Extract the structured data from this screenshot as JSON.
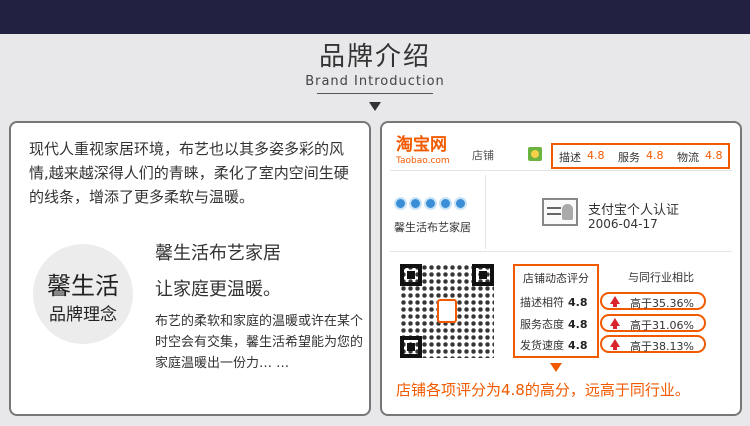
{
  "header": {
    "title_cn": "品牌介绍",
    "title_en": "Brand Introduction"
  },
  "left": {
    "intro": "现代人重视家居环境，布艺也以其多姿多彩的风情,越来越深得人们的青睐，柔化了室内空间生硬的线条，增添了更多柔软与温暖。",
    "circle_line1": "馨生活",
    "circle_line2": "品牌理念",
    "slogan1": "馨生活布艺家居",
    "slogan2": "让家庭更温暖。",
    "paragraph": "布艺的柔软和家庭的温暖或许在某个时空会有交集，馨生活希望能为您的家庭温暖出一份力… …"
  },
  "right": {
    "taobao_logo": "淘宝网",
    "taobao_sub": "Taobao.com",
    "store_label": "店铺",
    "scores": [
      {
        "label": "描述",
        "value": "4.8"
      },
      {
        "label": "服务",
        "value": "4.8"
      },
      {
        "label": "物流",
        "value": "4.8"
      }
    ],
    "store_name": "馨生活布艺家居",
    "alipay_label": "支付宝个人认证",
    "alipay_date": "2006-04-17",
    "dynamic_title": "店铺动态评分",
    "dynamic": [
      {
        "label": "描述相符",
        "value": "4.8"
      },
      {
        "label": "服务态度",
        "value": "4.8"
      },
      {
        "label": "发货速度",
        "value": "4.8"
      }
    ],
    "compare_title": "与同行业相比",
    "compare": [
      "高于35.36%",
      "高于31.06%",
      "高于38.13%"
    ],
    "summary": "店铺各项评分为4.8的高分，远高于同行业。"
  },
  "colors": {
    "accent": "#f25a00",
    "topbar": "#232142"
  }
}
